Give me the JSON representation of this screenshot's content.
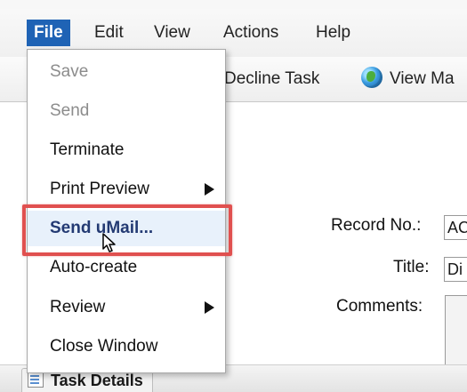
{
  "menubar": {
    "items": [
      {
        "label": "File",
        "active": true
      },
      {
        "label": "Edit"
      },
      {
        "label": "View"
      },
      {
        "label": "Actions"
      },
      {
        "label": "Help"
      }
    ]
  },
  "toolbar": {
    "decline_task_label": "Decline Task",
    "view_map_label": "View Ma"
  },
  "form": {
    "record_no_label": "Record No.:",
    "record_no_value": "AC",
    "title_label": "Title:",
    "title_value": "Di",
    "comments_label": "Comments:"
  },
  "file_menu": {
    "items": [
      {
        "label": "Save",
        "state": "disabled"
      },
      {
        "label": "Send",
        "state": "disabled"
      },
      {
        "label": "Terminate",
        "state": "enabled"
      },
      {
        "label": "Print Preview",
        "state": "enabled",
        "submenu": true
      },
      {
        "label": "Send uMail...",
        "state": "highlighted"
      },
      {
        "label": "Auto-create",
        "state": "enabled"
      },
      {
        "label": "Review",
        "state": "enabled",
        "submenu": true
      },
      {
        "label": "Close Window",
        "state": "enabled"
      }
    ]
  },
  "bottom_tabs": {
    "task_details_label": "Task Details"
  },
  "colors": {
    "menu_active_bg": "#1f63b5",
    "highlight_border": "#e0504f",
    "hover_item_text": "#233a73"
  }
}
